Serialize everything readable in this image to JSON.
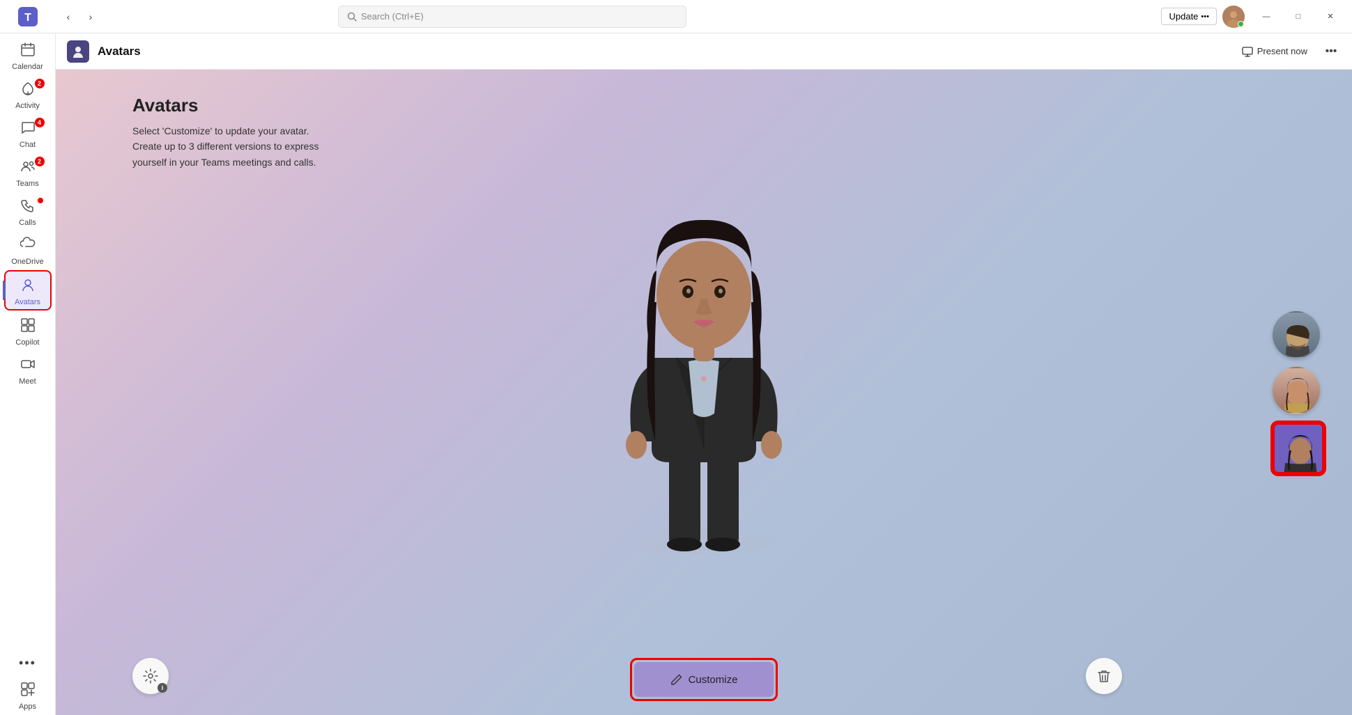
{
  "titlebar": {
    "search_placeholder": "Search (Ctrl+E)",
    "update_label": "Update",
    "update_dots": "•••",
    "minimize": "—",
    "maximize": "□",
    "close": "✕"
  },
  "sidebar": {
    "items": [
      {
        "id": "calendar",
        "label": "Calendar",
        "icon": "📅",
        "badge": null,
        "dot": false
      },
      {
        "id": "activity",
        "label": "Activity",
        "icon": "🔔",
        "badge": "2",
        "dot": false
      },
      {
        "id": "chat",
        "label": "Chat",
        "icon": "💬",
        "badge": "4",
        "dot": false
      },
      {
        "id": "teams",
        "label": "Teams",
        "icon": "👥",
        "badge": "2",
        "dot": false
      },
      {
        "id": "calls",
        "label": "Calls",
        "icon": "📞",
        "badge": null,
        "dot": true
      },
      {
        "id": "onedrive",
        "label": "OneDrive",
        "icon": "☁",
        "badge": null,
        "dot": false
      },
      {
        "id": "avatars",
        "label": "Avatars",
        "icon": "👤",
        "badge": null,
        "dot": false,
        "active": true
      },
      {
        "id": "copilot",
        "label": "Copilot",
        "icon": "⊞",
        "badge": null,
        "dot": false
      },
      {
        "id": "meet",
        "label": "Meet",
        "icon": "🎥",
        "badge": null,
        "dot": false
      }
    ],
    "more_label": "•••",
    "apps_label": "Apps",
    "apps_icon": "⊕"
  },
  "app_header": {
    "title": "Avatars",
    "icon": "👤",
    "present_label": "Present now",
    "present_icon": "⊡",
    "more_icon": "•••"
  },
  "main": {
    "title": "Avatars",
    "desc_line1": "Select 'Customize' to update your avatar.",
    "desc_line2": "Create up to 3 different versions to express",
    "desc_line3": "yourself in your Teams meetings and calls.",
    "customize_label": "Customize"
  },
  "colors": {
    "accent": "#5b5fc7",
    "active_bg": "#ede9fb",
    "badge_red": "#cc0000",
    "customize_btn": "#a090d0",
    "avatar_bg_selected": "#8070c0"
  }
}
